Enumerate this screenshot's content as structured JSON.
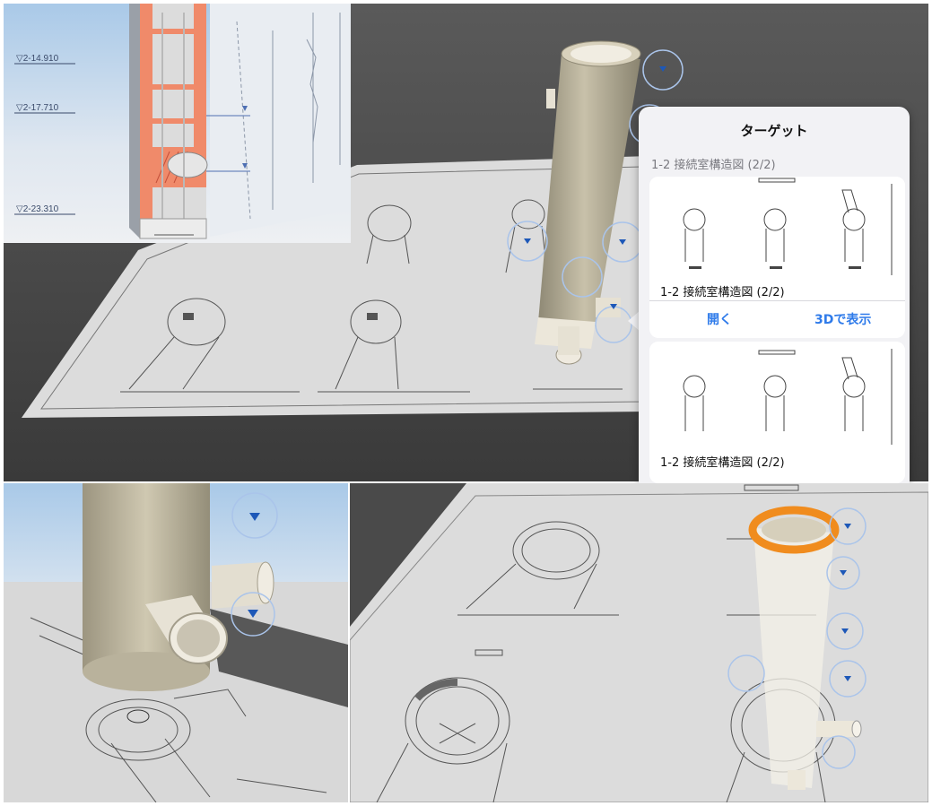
{
  "level_labels": [
    "▽2-14.910",
    "▽2-17.710",
    "▽2-23.310"
  ],
  "target_panel": {
    "title": "ターゲット",
    "section_header": "1-2 接続室構造図 (2/2)",
    "cards": [
      {
        "label": "1-2 接続室構造図 (2/2)",
        "open_label": "開く",
        "view3d_label": "3Dで表示"
      },
      {
        "label": "1-2 接続室構造図 (2/2)"
      }
    ]
  },
  "colors": {
    "section_cut": "#f08a6a",
    "pipe": "#c2bba3",
    "selection_highlight": "#f08c1e",
    "ar_marker": "#aac4ea",
    "marker_arrow": "#1d58b8",
    "link_blue": "#2f7bea"
  },
  "icons": [
    "target-marker-icon",
    "triangle-down-icon"
  ]
}
